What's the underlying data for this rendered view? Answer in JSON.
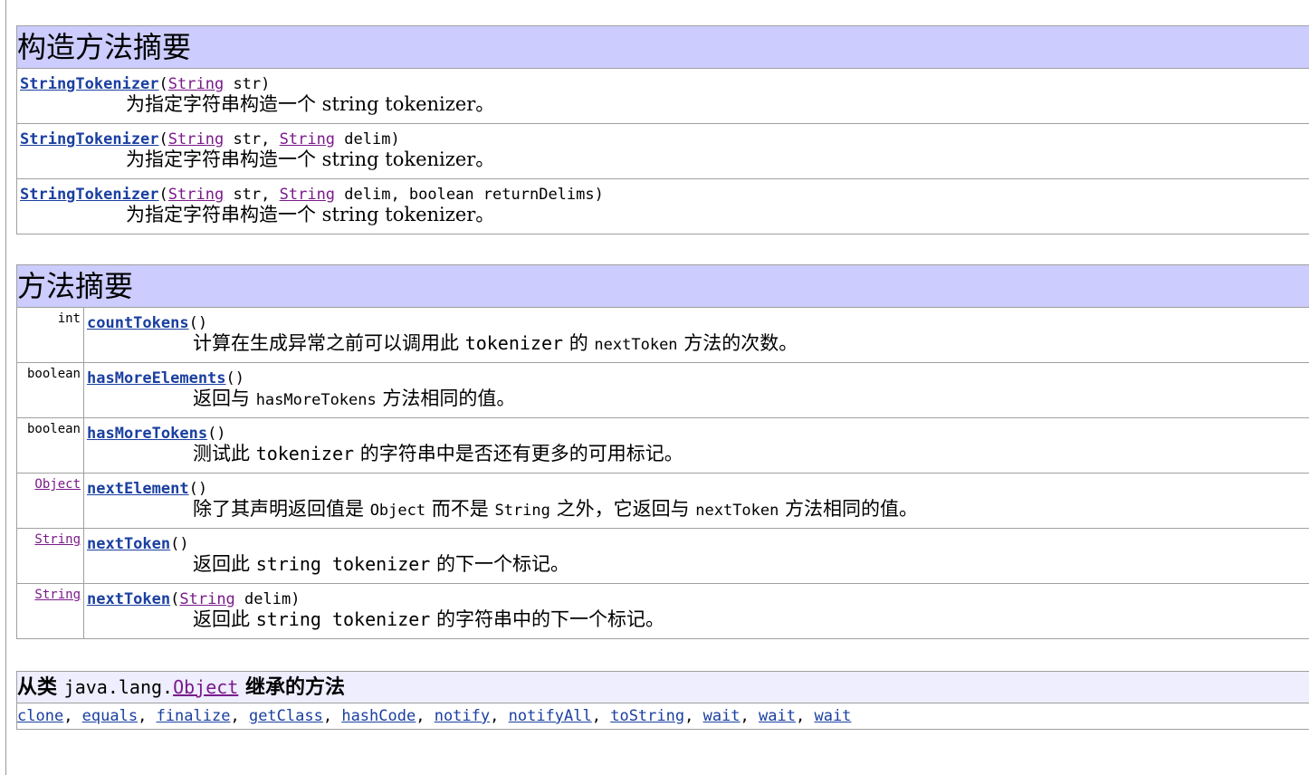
{
  "constructor_summary": {
    "title": "构造方法摘要",
    "rows": [
      {
        "name": "StringTokenizer",
        "open": "(",
        "params": [
          {
            "type": "String",
            "name": " str"
          }
        ],
        "close": ")",
        "desc": "为指定字符串构造一个 string tokenizer。"
      },
      {
        "name": "StringTokenizer",
        "open": "(",
        "params": [
          {
            "type": "String",
            "name": " str, "
          },
          {
            "type": "String",
            "name": " delim"
          }
        ],
        "close": ")",
        "desc": "为指定字符串构造一个 string tokenizer。"
      },
      {
        "name": "StringTokenizer",
        "open": "(",
        "params": [
          {
            "type": "String",
            "name": " str, "
          },
          {
            "type": "String",
            "name": " delim, boolean returnDelims"
          }
        ],
        "close": ")",
        "desc": "为指定字符串构造一个 string tokenizer。"
      }
    ]
  },
  "method_summary": {
    "title": "方法摘要",
    "rows": [
      {
        "rtype": "int",
        "rtype_link": false,
        "name": "countTokens",
        "args": "()",
        "desc_parts": [
          [
            "计算在生成异常之前可以调用此 ",
            ""
          ],
          [
            "tokenizer",
            "mono"
          ],
          [
            " 的 ",
            ""
          ],
          [
            "nextToken",
            "sm"
          ],
          [
            " 方法的次数。",
            ""
          ]
        ]
      },
      {
        "rtype": "boolean",
        "rtype_link": false,
        "name": "hasMoreElements",
        "args": "()",
        "desc_parts": [
          [
            "返回与 ",
            ""
          ],
          [
            "hasMoreTokens",
            "sm"
          ],
          [
            " 方法相同的值。",
            ""
          ]
        ]
      },
      {
        "rtype": "boolean",
        "rtype_link": false,
        "name": "hasMoreTokens",
        "args": "()",
        "desc_parts": [
          [
            "测试此 ",
            ""
          ],
          [
            "tokenizer",
            "mono"
          ],
          [
            " 的字符串中是否还有更多的可用标记。",
            ""
          ]
        ]
      },
      {
        "rtype": "Object",
        "rtype_link": true,
        "name": "nextElement",
        "args": "()",
        "desc_parts": [
          [
            "除了其声明返回值是 ",
            ""
          ],
          [
            "Object",
            "sm"
          ],
          [
            " 而不是 ",
            ""
          ],
          [
            "String",
            "sm"
          ],
          [
            " 之外，它返回与 ",
            ""
          ],
          [
            "nextToken",
            "sm"
          ],
          [
            " 方法相同的值。",
            ""
          ]
        ]
      },
      {
        "rtype": "String",
        "rtype_link": true,
        "name": "nextToken",
        "args": "()",
        "desc_parts": [
          [
            "返回此 ",
            ""
          ],
          [
            "string tokenizer",
            "mono"
          ],
          [
            " 的下一个标记。",
            ""
          ]
        ]
      },
      {
        "rtype": "String",
        "rtype_link": true,
        "name": "nextToken",
        "args": "(String delim)",
        "desc_parts": [
          [
            "返回此 ",
            ""
          ],
          [
            "string tokenizer",
            "mono"
          ],
          [
            " 的字符串中的下一个标记。",
            ""
          ]
        ]
      }
    ]
  },
  "inherited": {
    "prefix": "从类 ",
    "pkg": "java.lang.",
    "cls": "Object",
    "suffix": " 继承的方法",
    "methods": [
      "clone",
      "equals",
      "finalize",
      "getClass",
      "hashCode",
      "notify",
      "notifyAll",
      "toString",
      "wait",
      "wait",
      "wait"
    ]
  }
}
